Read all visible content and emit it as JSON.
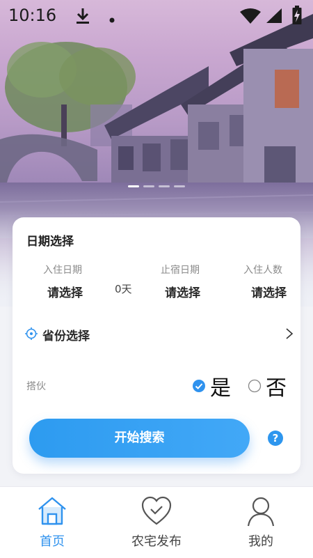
{
  "status_bar": {
    "time": "10:16",
    "icons": [
      "download-icon",
      "notification-dot-icon",
      "wifi-icon",
      "signal-icon",
      "battery-charging-icon"
    ]
  },
  "banner": {
    "image": "water-town-canal-scene",
    "carousel": {
      "count": 4,
      "active_index": 0
    }
  },
  "booking": {
    "title": "日期选择",
    "check_in": {
      "label": "入住日期",
      "value": "请选择"
    },
    "nights": "0天",
    "check_out": {
      "label": "止宿日期",
      "value": "请选择"
    },
    "guests": {
      "label": "入住人数",
      "value": "请选择"
    },
    "province": {
      "label": "省份选择",
      "icon": "location-target-icon"
    },
    "partner": {
      "label": "搭伙",
      "options": [
        {
          "label": "是",
          "selected": true
        },
        {
          "label": "否",
          "selected": false
        }
      ]
    },
    "search_label": "开始搜索",
    "help_label": "?"
  },
  "tabbar": {
    "items": [
      {
        "label": "首页",
        "icon": "home-icon",
        "active": true
      },
      {
        "label": "农宅发布",
        "icon": "heart-check-icon",
        "active": false
      },
      {
        "label": "我的",
        "icon": "person-icon",
        "active": false
      }
    ]
  },
  "colors": {
    "accent": "#2f92ee",
    "button": "#39a2f4",
    "text_primary": "#222222",
    "text_secondary": "#8a8a8a"
  }
}
